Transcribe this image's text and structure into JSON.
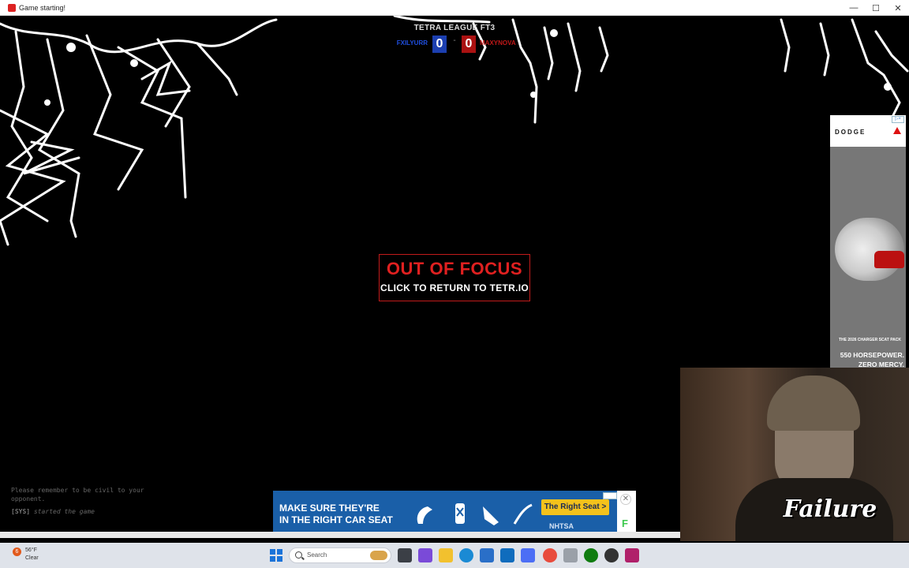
{
  "window": {
    "title": "Game starting!",
    "controls": [
      "—",
      "☐",
      "✕"
    ]
  },
  "scoreboard": {
    "title": "TETRA LEAGUE FT3",
    "player_left": "FXILYURR",
    "score_left": "0",
    "separator": "-",
    "score_right": "0",
    "player_right": "MAXYNOVA",
    "colors": {
      "left": "#1c3fb0",
      "right": "#aa1111"
    }
  },
  "focus_overlay": {
    "title": "OUT OF FOCUS",
    "subtitle": "CLICK TO RETURN TO TETR.IO"
  },
  "chat": {
    "notice": "Please remember to be civil to your opponent.",
    "system_tag": "[SYS]",
    "system_message": "started the game"
  },
  "ad_right": {
    "brand": "DODGE",
    "small_text": "THE 2026 CHARGER SCAT PACK",
    "headline_1": "550 HORSEPOWER.",
    "headline_2": "ZERO MERCY."
  },
  "ad_bottom": {
    "line_1": "MAKE SURE THEY'RE",
    "line_2": "IN THE RIGHT CAR SEAT",
    "cta": "The Right Seat >",
    "sponsor": "NHTSA",
    "close": "✕",
    "feedback": "F"
  },
  "webcam": {
    "overlay_text": "Failure"
  },
  "taskbar": {
    "weather_badge": "6",
    "weather_temp": "56°F",
    "weather_condition": "Clear",
    "search_label": "Search"
  },
  "icons": [
    "app-icon",
    "search-icon",
    "start-icon",
    "close-icon"
  ]
}
